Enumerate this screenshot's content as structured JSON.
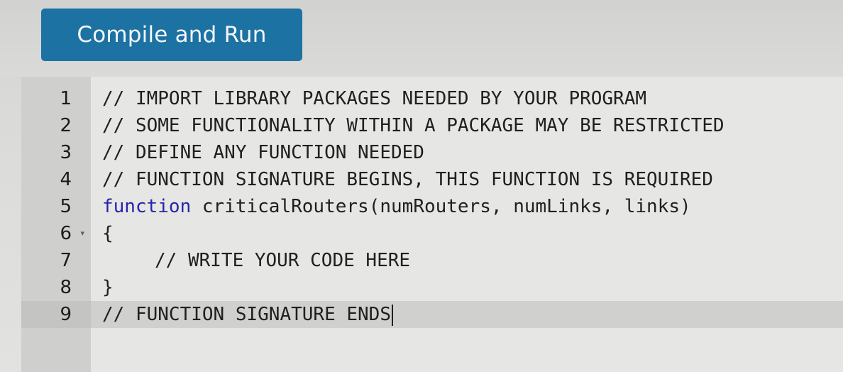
{
  "toolbar": {
    "run_label": "Compile and Run"
  },
  "editor": {
    "line_numbers": [
      "1",
      "2",
      "3",
      "4",
      "5",
      "6",
      "7",
      "8",
      "9"
    ],
    "lines": [
      {
        "text": "// IMPORT LIBRARY PACKAGES NEEDED BY YOUR PROGRAM"
      },
      {
        "text": "// SOME FUNCTIONALITY WITHIN A PACKAGE MAY BE RESTRICTED"
      },
      {
        "text": "// DEFINE ANY FUNCTION NEEDED"
      },
      {
        "text": "// FUNCTION SIGNATURE BEGINS, THIS FUNCTION IS REQUIRED"
      },
      {
        "keyword": "function",
        "name": "criticalRouters",
        "params": "(numRouters, numLinks, links)"
      },
      {
        "text": "{"
      },
      {
        "text": "// WRITE YOUR CODE HERE"
      },
      {
        "text": "}"
      },
      {
        "text": "// FUNCTION SIGNATURE ENDS"
      }
    ],
    "active_line": 9,
    "fold_indicator": "▾"
  },
  "icons": {
    "fold_icon": "chevron-down-icon"
  },
  "colors": {
    "button_bg": "#1c72a2",
    "keyword": "#2626a8",
    "text": "#202020"
  }
}
